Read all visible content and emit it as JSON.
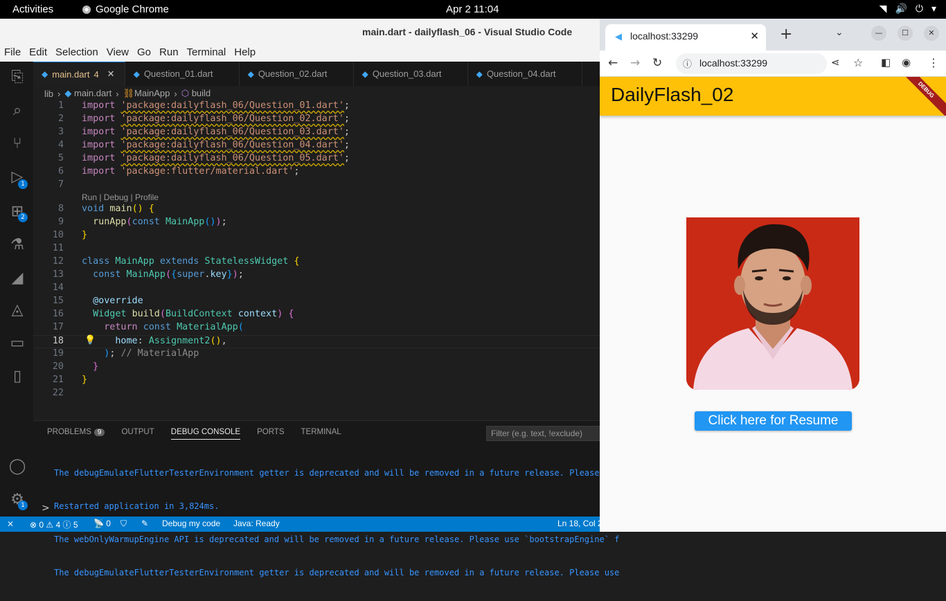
{
  "topbar": {
    "activities": "Activities",
    "app_name": "Google Chrome",
    "clock": "Apr 2  11:04"
  },
  "vscode": {
    "window_title": "main.dart - dailyflash_06 - Visual Studio Code",
    "menu": [
      "File",
      "Edit",
      "Selection",
      "View",
      "Go",
      "Run",
      "Terminal",
      "Help"
    ],
    "activity_badges": {
      "run_debug": "1",
      "extensions": "2",
      "settings": "1"
    },
    "tabs": [
      {
        "label": "main.dart",
        "badge": "4"
      },
      {
        "label": "Question_01.dart"
      },
      {
        "label": "Question_02.dart"
      },
      {
        "label": "Question_03.dart"
      },
      {
        "label": "Question_04.dart"
      }
    ],
    "breadcrumb": [
      "lib",
      "main.dart",
      "MainApp",
      "build"
    ],
    "codelens": "Run | Debug | Profile",
    "panel": {
      "tabs": [
        "PROBLEMS",
        "OUTPUT",
        "DEBUG CONSOLE",
        "PORTS",
        "TERMINAL"
      ],
      "problems_count": "9",
      "filter_placeholder": "Filter (e.g. text, !exclude)",
      "console": [
        "The debugEmulateFlutterTesterEnvironment getter is deprecated and will be removed in a future release. Please use",
        "Restarted application in 3,824ms.",
        "The webOnlyWarmupEngine API is deprecated and will be removed in a future release. Please use `bootstrapEngine` f",
        "The debugEmulateFlutterTesterEnvironment getter is deprecated and will be removed in a future release. Please use"
      ],
      "prompt": ">"
    },
    "status": {
      "problems": "⊗ 0 ⚠ 4 ⓘ 5",
      "ports": "0",
      "debug": "Debug my code",
      "java": "Java: Ready",
      "position": "Ln 18, Col 2"
    }
  },
  "chrome": {
    "tab_title": "localhost:33299",
    "url": "localhost:33299",
    "app": {
      "title": "DailyFlash_02",
      "debug_banner": "DEBUG",
      "resume_button": "Click here for Resume",
      "colors": {
        "appbar": "#ffc107",
        "button": "#2196f3",
        "photo_bg": "#c92a16"
      }
    }
  }
}
